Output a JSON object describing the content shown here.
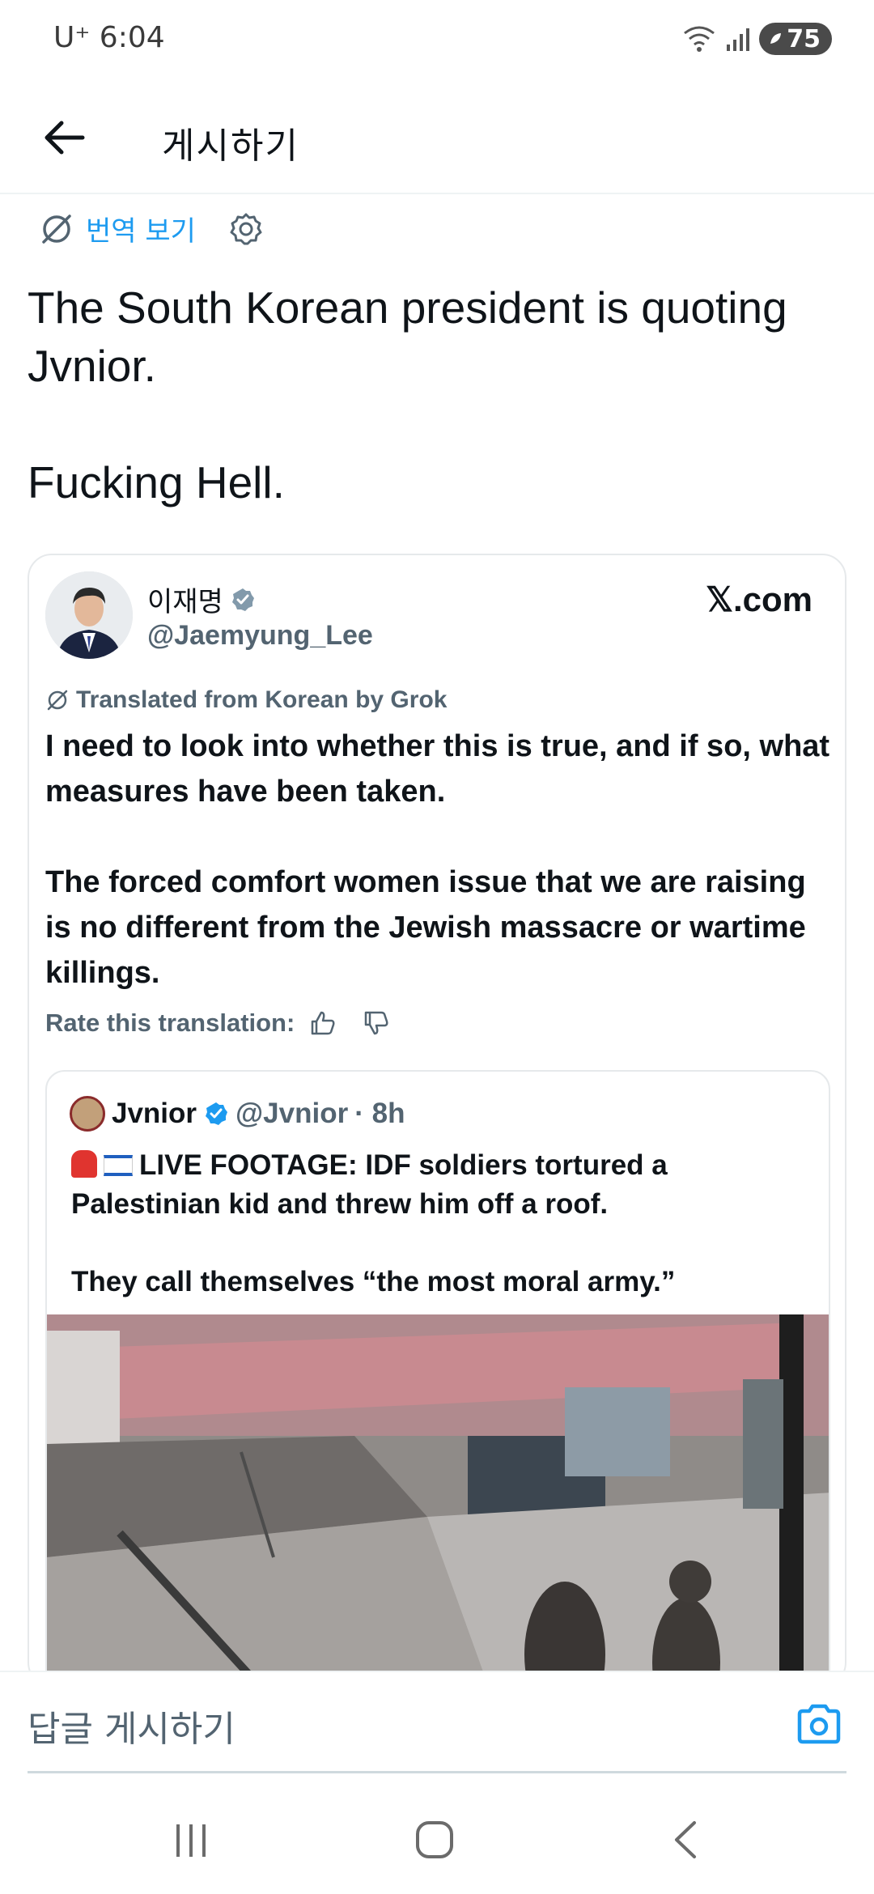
{
  "status_bar": {
    "carrier_time": "U⁺ 6:04",
    "battery": "75"
  },
  "top_bar": {
    "title": "게시하기"
  },
  "translate": {
    "label": "번역 보기"
  },
  "post": {
    "paragraphs": [
      "The South Korean president is quoting Jvnior.",
      "Fucking Hell."
    ]
  },
  "embed": {
    "author_name": "이재명",
    "handle": "@Jaemyung_Lee",
    "site": "𝕏.com",
    "grok_label": "Translated from Korean by Grok",
    "translated_paragraphs": [
      "I need to look into whether this is true, and if so, what measures have been taken.",
      "The forced comfort women issue that we are raising is no different from the Jewish massacre or wartime killings."
    ],
    "rate_label": "Rate this translation:",
    "quote": {
      "name": "Jvnior",
      "handle": "@Jvnior",
      "time": "· 8h",
      "headline": "LIVE FOOTAGE: IDF soldiers tortured a Palestinian kid and threw him off a roof.",
      "line2": "They call themselves “the most moral army.”"
    }
  },
  "reply_bar": {
    "placeholder": "답글 게시하기"
  },
  "colors": {
    "accent": "#1d9bf0",
    "secondary_text": "#536471",
    "verified": "#1d9bf0",
    "grey_verified": "#829aab"
  },
  "icons": [
    "back-arrow-icon",
    "translate-icon",
    "gear-icon",
    "verified-badge-icon",
    "thumbs-up-icon",
    "thumbs-down-icon",
    "camera-icon",
    "siren-emoji-icon",
    "israel-flag-icon",
    "wifi-icon",
    "signal-icon",
    "battery-icon",
    "recents-icon",
    "home-icon",
    "nav-back-icon"
  ]
}
